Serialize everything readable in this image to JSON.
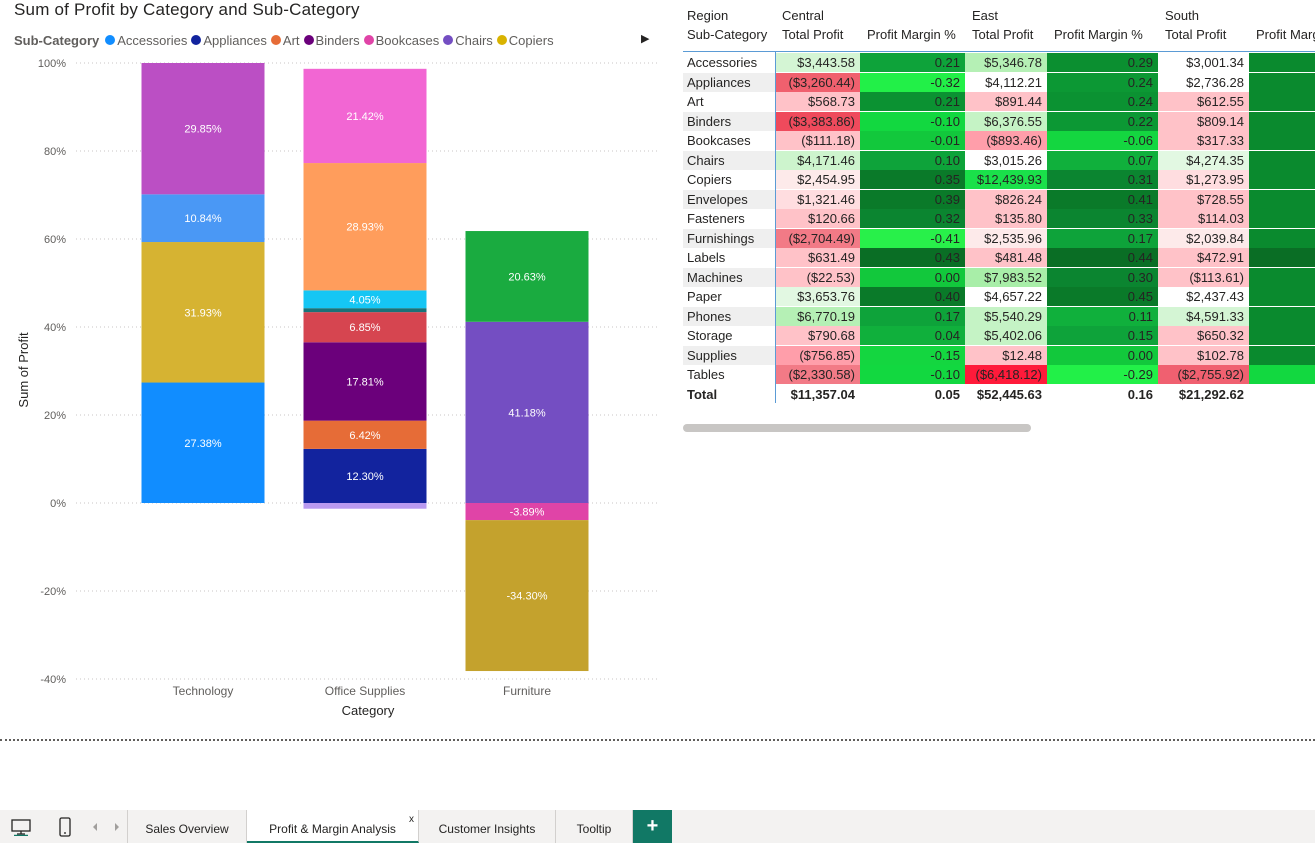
{
  "chart_data": {
    "type": "bar",
    "title": "Sum of Profit by Category and Sub-Category",
    "xlabel": "Category",
    "ylabel": "Sum of Profit",
    "ylim": [
      -40,
      100
    ],
    "yticks": [
      "100%",
      "80%",
      "60%",
      "40%",
      "20%",
      "0%",
      "-20%",
      "-40%"
    ],
    "grid": true,
    "legend_title": "Sub-Category",
    "legend": [
      {
        "name": "Accessories",
        "color": "#118dff"
      },
      {
        "name": "Appliances",
        "color": "#12239e"
      },
      {
        "name": "Art",
        "color": "#e66c37"
      },
      {
        "name": "Binders",
        "color": "#6b007b"
      },
      {
        "name": "Bookcases",
        "color": "#e044a7"
      },
      {
        "name": "Chairs",
        "color": "#744ec2"
      },
      {
        "name": "Copiers",
        "color": "#d9b300"
      }
    ],
    "categories": [
      "Technology",
      "Office Supplies",
      "Furniture"
    ],
    "stacks": [
      {
        "category": "Technology",
        "segments": [
          {
            "value": 27.38,
            "label": "27.38%",
            "color": "#118dff"
          },
          {
            "value": 31.93,
            "label": "31.93%",
            "color": "#d6b332"
          },
          {
            "value": 10.84,
            "label": "10.84%",
            "color": "#4a98f5"
          },
          {
            "value": 29.85,
            "label": "29.85%",
            "color": "#bb4fc4"
          }
        ]
      },
      {
        "category": "Office Supplies",
        "segments": [
          {
            "value": -1.3,
            "label": "",
            "color": "#b99af0"
          },
          {
            "value": 12.3,
            "label": "12.30%",
            "color": "#12239e"
          },
          {
            "value": 6.42,
            "label": "6.42%",
            "color": "#e66c37"
          },
          {
            "value": 17.81,
            "label": "17.81%",
            "color": "#6b007b"
          },
          {
            "value": 6.85,
            "label": "6.85%",
            "color": "#d64550"
          },
          {
            "value": 0.9,
            "label": "",
            "color": "#197278"
          },
          {
            "value": 4.05,
            "label": "4.05%",
            "color": "#15c6f4"
          },
          {
            "value": 28.93,
            "label": "28.93%",
            "color": "#ff9d5c"
          },
          {
            "value": 21.42,
            "label": "21.42%",
            "color": "#f266d3"
          }
        ]
      },
      {
        "category": "Furniture",
        "segments": [
          {
            "value": -3.89,
            "label": "-3.89%",
            "color": "#e044a7"
          },
          {
            "value": -34.3,
            "label": "-34.30%",
            "color": "#c4a22d"
          },
          {
            "value": 41.18,
            "label": "41.18%",
            "color": "#744ec2"
          },
          {
            "value": 20.63,
            "label": "20.63%",
            "color": "#1aab40"
          }
        ]
      }
    ]
  },
  "matrix": {
    "row_header_1": "Region",
    "row_header_2": "Sub-Category",
    "regions": [
      "Central",
      "East",
      "South"
    ],
    "measure_headers": [
      "Total Profit",
      "Profit Margin %",
      "Total Profit",
      "Profit Margin %",
      "Total Profit",
      "Profit Margi"
    ],
    "rows": [
      {
        "name": "Accessories",
        "cells": [
          [
            "$3,443.58",
            "#d4f5d4"
          ],
          [
            "0.21",
            "#0ea33a"
          ],
          [
            "$5,346.78",
            "#b5f0b5"
          ],
          [
            "0.29",
            "#0b8f30"
          ],
          [
            "$3,001.34",
            "#ffffff"
          ],
          [
            "",
            "#0a8a2e"
          ]
        ]
      },
      {
        "name": "Appliances",
        "cells": [
          [
            "($3,260.44)",
            "#f0606e"
          ],
          [
            "-0.32",
            "#22f048"
          ],
          [
            "$4,112.21",
            "#ffffff"
          ],
          [
            "0.24",
            "#0c9834"
          ],
          [
            "$2,736.28",
            "#ffffff"
          ],
          [
            "",
            "#0a8a2e"
          ]
        ]
      },
      {
        "name": "Art",
        "cells": [
          [
            "$568.73",
            "#ffc2c8"
          ],
          [
            "0.21",
            "#0b9232"
          ],
          [
            "$891.44",
            "#ffc2c8"
          ],
          [
            "0.24",
            "#0b9232"
          ],
          [
            "$612.55",
            "#ffc2c8"
          ],
          [
            "",
            "#0a8a2e"
          ]
        ]
      },
      {
        "name": "Binders",
        "cells": [
          [
            "($3,383.86)",
            "#ef4a5c"
          ],
          [
            "-0.10",
            "#12d840"
          ],
          [
            "$6,376.55",
            "#c5f3c5"
          ],
          [
            "0.22",
            "#0c9834"
          ],
          [
            "$809.14",
            "#ffc2c8"
          ],
          [
            "",
            "#0a8a2e"
          ]
        ]
      },
      {
        "name": "Bookcases",
        "cells": [
          [
            "($111.18)",
            "#ffc2c8"
          ],
          [
            "-0.01",
            "#12c83c"
          ],
          [
            "($893.46)",
            "#ff9eaa"
          ],
          [
            "-0.06",
            "#14d640"
          ],
          [
            "$317.33",
            "#ffc2c8"
          ],
          [
            "",
            "#0a8a2e"
          ]
        ]
      },
      {
        "name": "Chairs",
        "cells": [
          [
            "$4,171.46",
            "#cdf4cd"
          ],
          [
            "0.10",
            "#0ea33a"
          ],
          [
            "$3,015.26",
            "#ffffff"
          ],
          [
            "0.07",
            "#10b03c"
          ],
          [
            "$4,274.35",
            "#e2f8e2"
          ],
          [
            "",
            "#0a8a2e"
          ]
        ]
      },
      {
        "name": "Copiers",
        "cells": [
          [
            "$2,454.95",
            "#fdeaea"
          ],
          [
            "0.35",
            "#0a7a29"
          ],
          [
            "$12,439.93",
            "#1ae04a"
          ],
          [
            "0.31",
            "#0b8530"
          ],
          [
            "$1,273.95",
            "#ffdde0"
          ],
          [
            "",
            "#0a8a2e"
          ]
        ]
      },
      {
        "name": "Envelopes",
        "cells": [
          [
            "$1,321.46",
            "#ffdde0"
          ],
          [
            "0.39",
            "#0a7a29"
          ],
          [
            "$826.24",
            "#ffc2c8"
          ],
          [
            "0.41",
            "#0a7a29"
          ],
          [
            "$728.55",
            "#ffc2c8"
          ],
          [
            "",
            "#0a8a2e"
          ]
        ]
      },
      {
        "name": "Fasteners",
        "cells": [
          [
            "$120.66",
            "#ffc2c8"
          ],
          [
            "0.32",
            "#0b8530"
          ],
          [
            "$135.80",
            "#ffc2c8"
          ],
          [
            "0.33",
            "#0b8530"
          ],
          [
            "$114.03",
            "#ffc2c8"
          ],
          [
            "",
            "#0a8a2e"
          ]
        ]
      },
      {
        "name": "Furnishings",
        "cells": [
          [
            "($2,704.49)",
            "#f27a86"
          ],
          [
            "-0.41",
            "#28f04a"
          ],
          [
            "$2,535.96",
            "#fdeaea"
          ],
          [
            "0.17",
            "#0ea33a"
          ],
          [
            "$2,039.84",
            "#fdeaea"
          ],
          [
            "",
            "#0a8a2e"
          ]
        ]
      },
      {
        "name": "Labels",
        "cells": [
          [
            "$631.49",
            "#ffc2c8"
          ],
          [
            "0.43",
            "#0a6e25"
          ],
          [
            "$481.48",
            "#ffc2c8"
          ],
          [
            "0.44",
            "#0a6e25"
          ],
          [
            "$472.91",
            "#ffc2c8"
          ],
          [
            "",
            "#0a6e25"
          ]
        ]
      },
      {
        "name": "Machines",
        "cells": [
          [
            "($22.53)",
            "#ffc2c8"
          ],
          [
            "0.00",
            "#12c83c"
          ],
          [
            "$7,983.52",
            "#a8eea8"
          ],
          [
            "0.30",
            "#0b8530"
          ],
          [
            "($113.61)",
            "#ffc2c8"
          ],
          [
            "",
            "#0a8a2e"
          ]
        ]
      },
      {
        "name": "Paper",
        "cells": [
          [
            "$3,653.76",
            "#e2f8e2"
          ],
          [
            "0.40",
            "#0a7a29"
          ],
          [
            "$4,657.22",
            "#ffffff"
          ],
          [
            "0.45",
            "#0a7a29"
          ],
          [
            "$2,437.43",
            "#ffffff"
          ],
          [
            "",
            "#0a8a2e"
          ]
        ]
      },
      {
        "name": "Phones",
        "cells": [
          [
            "$6,770.19",
            "#b5f0b5"
          ],
          [
            "0.17",
            "#0ea33a"
          ],
          [
            "$5,540.29",
            "#c5f3c5"
          ],
          [
            "0.11",
            "#10b03c"
          ],
          [
            "$4,591.33",
            "#d4f5d4"
          ],
          [
            "",
            "#0a8a2e"
          ]
        ]
      },
      {
        "name": "Storage",
        "cells": [
          [
            "$790.68",
            "#ffc2c8"
          ],
          [
            "0.04",
            "#10b03c"
          ],
          [
            "$5,402.06",
            "#c5f3c5"
          ],
          [
            "0.15",
            "#0ea33a"
          ],
          [
            "$650.32",
            "#ffc2c8"
          ],
          [
            "",
            "#0a8a2e"
          ]
        ]
      },
      {
        "name": "Supplies",
        "cells": [
          [
            "($756.85)",
            "#ff9eaa"
          ],
          [
            "-0.15",
            "#14d640"
          ],
          [
            "$12.48",
            "#ffc2c8"
          ],
          [
            "0.00",
            "#12c83c"
          ],
          [
            "$102.78",
            "#ffc2c8"
          ],
          [
            "",
            "#0a8a2e"
          ]
        ]
      },
      {
        "name": "Tables",
        "cells": [
          [
            "($2,330.58)",
            "#f27a86"
          ],
          [
            "-0.10",
            "#12d840"
          ],
          [
            "($6,418.12)",
            "#ff1a3a"
          ],
          [
            "-0.29",
            "#22f048"
          ],
          [
            "($2,755.92)",
            "#f06070"
          ],
          [
            "",
            "#12d840"
          ]
        ]
      }
    ],
    "total": {
      "name": "Total",
      "cells": [
        "$11,357.04",
        "0.05",
        "$52,445.63",
        "0.16",
        "$21,292.62",
        "("
      ]
    }
  },
  "tabs": [
    {
      "label": "Sales Overview",
      "active": false
    },
    {
      "label": "Profit & Margin Analysis",
      "active": true
    },
    {
      "label": "Customer Insights",
      "active": false
    },
    {
      "label": "Tooltip",
      "active": false
    }
  ],
  "tab_close_glyph": "x",
  "add_page_glyph": "+",
  "legend_more_glyph": "▶"
}
